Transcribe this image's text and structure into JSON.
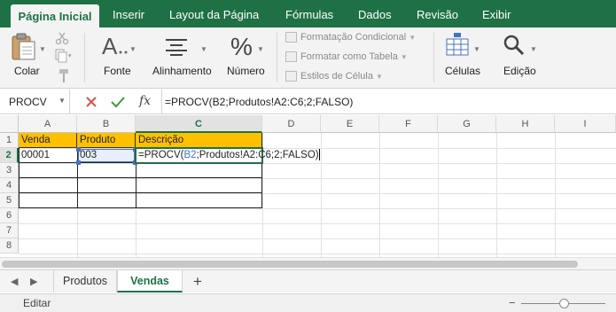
{
  "ribbon_tabs": [
    "Página Inicial",
    "Inserir",
    "Layout da Página",
    "Fórmulas",
    "Dados",
    "Revisão",
    "Exibir"
  ],
  "ribbon": {
    "paste_label": "Colar",
    "font_label": "Fonte",
    "align_label": "Alinhamento",
    "number_label": "Número",
    "percent_glyph": "%",
    "cond_format_label": "Formatação Condicional",
    "format_table_label": "Formatar como Tabela",
    "cell_styles_label": "Estilos de Célula",
    "cells_label": "Células",
    "edit_label": "Edição"
  },
  "formula_bar": {
    "name_box": "PROCV",
    "formula": "=PROCV(B2;Produtos!A2:C6;2;FALSO)"
  },
  "columns": [
    "A",
    "B",
    "C",
    "D",
    "E",
    "F",
    "G",
    "H",
    "I"
  ],
  "rows": [
    "1",
    "2",
    "3",
    "4",
    "5",
    "6",
    "7",
    "8"
  ],
  "cells": {
    "A1": "Venda",
    "B1": "Produto",
    "C1": "Descrição",
    "A2": "00001",
    "B2": "003",
    "C2_prefix": "=PROCV(",
    "C2_ref": "B2",
    "C2_suffix": ";Produtos!A2:C6;2;FALSO)"
  },
  "sheets": [
    "Produtos",
    "Vendas"
  ],
  "active_sheet": "Vendas",
  "add_sheet_glyph": "+",
  "status": "Editar",
  "colors": {
    "accent": "#1e7145",
    "header_fill": "#ffc000",
    "ref_blue": "#4472c4"
  }
}
